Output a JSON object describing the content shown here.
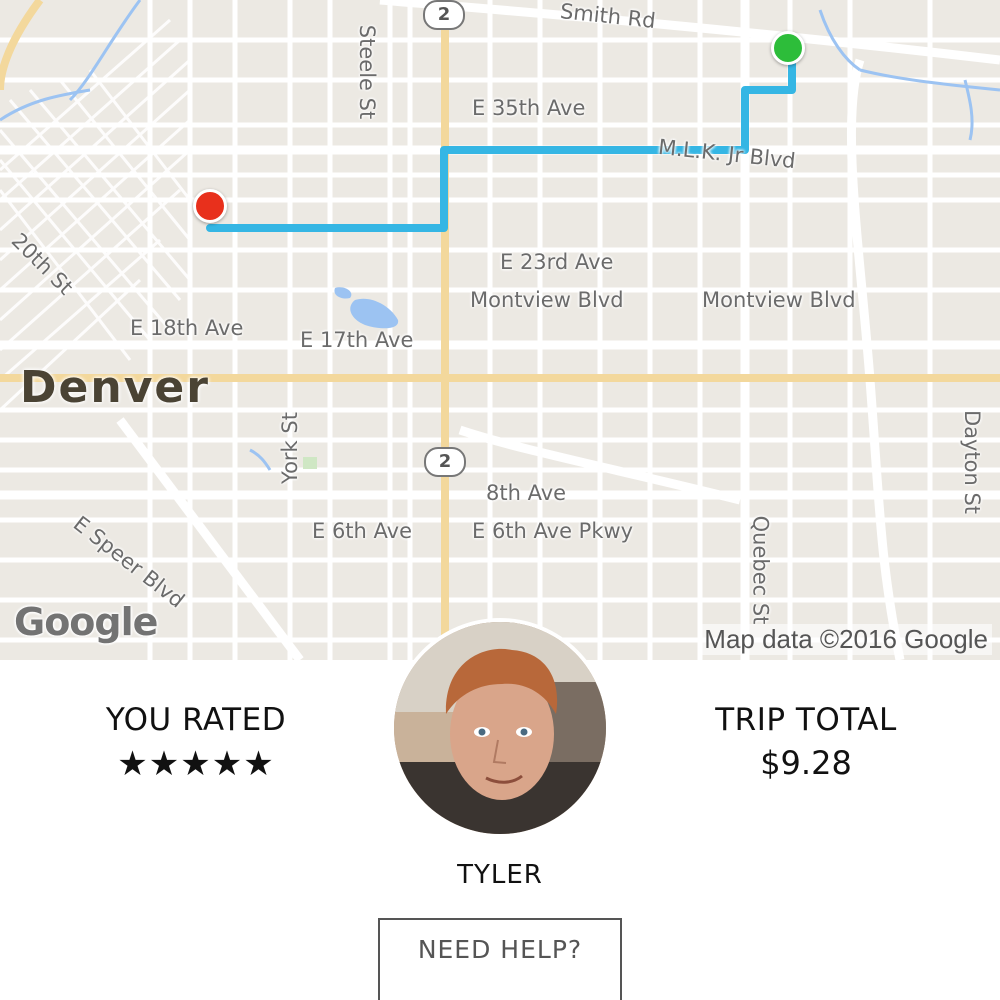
{
  "map": {
    "labels": {
      "smith_rd": "Smith Rd",
      "steele_st": "Steele St",
      "e_35th_ave": "E 35th Ave",
      "mlk_blvd": "M.L.K. Jr Blvd",
      "street_20th": "20th St",
      "e_23rd_ave": "E 23rd Ave",
      "montview_blvd_1": "Montview Blvd",
      "montview_blvd_2": "Montview Blvd",
      "e_18th_ave": "E 18th Ave",
      "e_17th_ave": "E 17th Ave",
      "york_st": "York St",
      "dayton_st": "Dayton St",
      "eighth_ave": "8th Ave",
      "e_6th_ave": "E 6th Ave",
      "e_6th_ave_pkwy": "E 6th Ave Pkwy",
      "quebec_st": "Quebec St",
      "e_speer_blvd": "E Speer Blvd"
    },
    "city": "Denver",
    "highway_shield_1": "2",
    "highway_shield_2": "2",
    "logo": "Google",
    "attribution": "Map data ©2016 Google",
    "colors": {
      "route": "#35b6e4",
      "pickup_pin": "#2dbd3a",
      "dropoff_pin": "#e8301c",
      "background": "#ece9e3",
      "major_road": "#f7dba0",
      "water": "#8ab4f8"
    }
  },
  "trip": {
    "rated_label": "YOU RATED",
    "rating_stars": "★★★★★",
    "total_label": "TRIP TOTAL",
    "total_value": "$9.28"
  },
  "driver": {
    "name": "TYLER",
    "avatar": "driver-photo"
  },
  "help_button": "NEED HELP?"
}
